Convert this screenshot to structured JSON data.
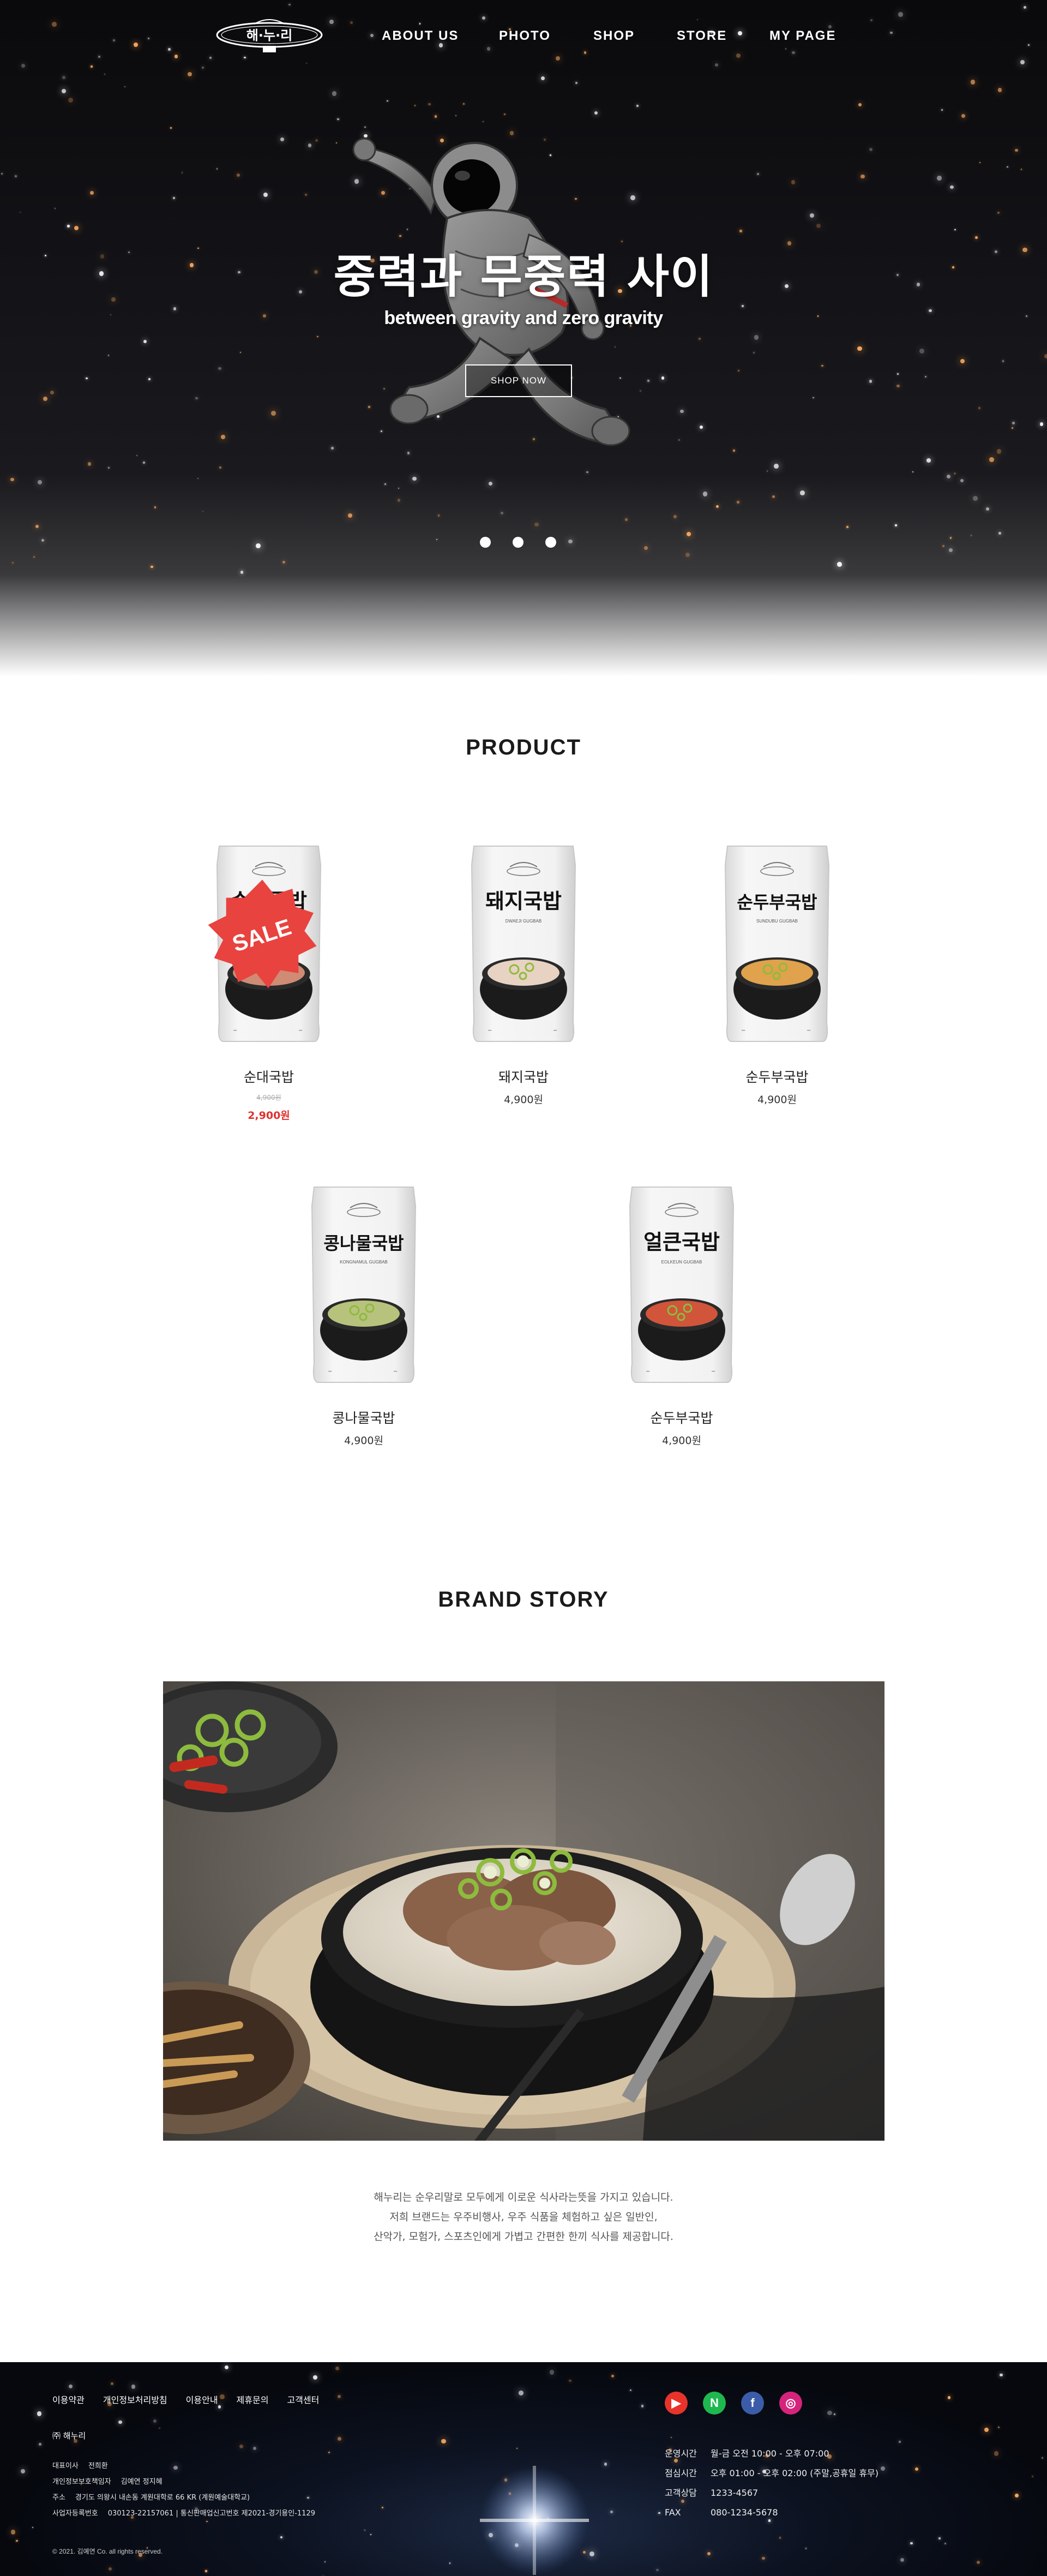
{
  "nav": {
    "logo_text": "해·누·리",
    "links": [
      "ABOUT US",
      "PHOTO",
      "SHOP",
      "STORE",
      "MY PAGE"
    ]
  },
  "hero": {
    "title": "중력과 무중력 사이",
    "subtitle": "between gravity and zero gravity",
    "button": "SHOP NOW",
    "slides": 3,
    "active_slide": 1
  },
  "products_section": {
    "title": "PRODUCT",
    "sale_badge": "SALE",
    "items": [
      {
        "label": "순대국밥",
        "pkg_title": "순대국밥",
        "pkg_en": "SUNDAE GUGBAB",
        "orig_price": "4,900원",
        "price": "2,900원",
        "sale": true,
        "bowl": "#cf8b73"
      },
      {
        "label": "돼지국밥",
        "pkg_title": "돼지국밥",
        "pkg_en": "DWAEJI GUGBAB",
        "price": "4,900원",
        "sale": false,
        "bowl": "#e8d2c2"
      },
      {
        "label": "순두부국밥",
        "pkg_title": "순두부국밥",
        "pkg_en": "SUNDUBU GUGBAB",
        "price": "4,900원",
        "sale": false,
        "bowl": "#e0a24c"
      },
      {
        "label": "콩나물국밥",
        "pkg_title": "콩나물국밥",
        "pkg_en": "KONGNAMUL GUGBAB",
        "price": "4,900원",
        "sale": false,
        "bowl": "#b7c37c"
      },
      {
        "label": "순두부국밥",
        "pkg_title": "얼큰국밥",
        "pkg_en": "EOLKEUN GUGBAB",
        "price": "4,900원",
        "sale": false,
        "bowl": "#d0553a"
      }
    ]
  },
  "brand": {
    "title": "BRAND STORY",
    "lines": [
      "해누리는 순우리말로 모두에게 이로운 식사라는뜻을 가지고 있습니다.",
      "저희 브랜드는 우주비행사, 우주 식품을 체험하고 싶은 일반인,",
      "산악가, 모험가, 스포츠인에게 가볍고 간편한 한끼 식사를 제공합니다."
    ]
  },
  "footer": {
    "links": [
      "이용약관",
      "개인정보처리방침",
      "이용안내",
      "제휴문의",
      "고객센터"
    ],
    "brand_name": "㈜ 해누리",
    "info": [
      [
        "대표이사",
        "전희환"
      ],
      [
        "개인정보보호책임자",
        "김예연  정지혜"
      ],
      [
        "주소",
        "경기도 의왕시 내손동 계원대학로 66 KR (계원예술대학교)"
      ],
      [
        "사업자등록번호",
        "030123-22157061   |   통신판매업신고번호   제2021-경기용인-1129"
      ]
    ],
    "copyright": "© 2021. 김예연 Co. all rights reserved.",
    "social": [
      {
        "icon": "youtube-icon",
        "glyph": "▶",
        "color": "#e8332b"
      },
      {
        "icon": "naver-icon",
        "glyph": "N",
        "color": "#1fb84f"
      },
      {
        "icon": "facebook-icon",
        "glyph": "f",
        "color": "#3b5ca8"
      },
      {
        "icon": "instagram-icon",
        "glyph": "◎",
        "color": "#d6247c"
      }
    ],
    "hours": [
      [
        "운영시간",
        "월-금 오전 10:00 - 오후 07:00"
      ],
      [
        "점심시간",
        "오후 01:00 - 오후 02:00 (주말,공휴일 휴무)"
      ],
      [
        "고객상담",
        "1233-4567"
      ],
      [
        "FAX",
        "080-1234-5678"
      ]
    ]
  }
}
